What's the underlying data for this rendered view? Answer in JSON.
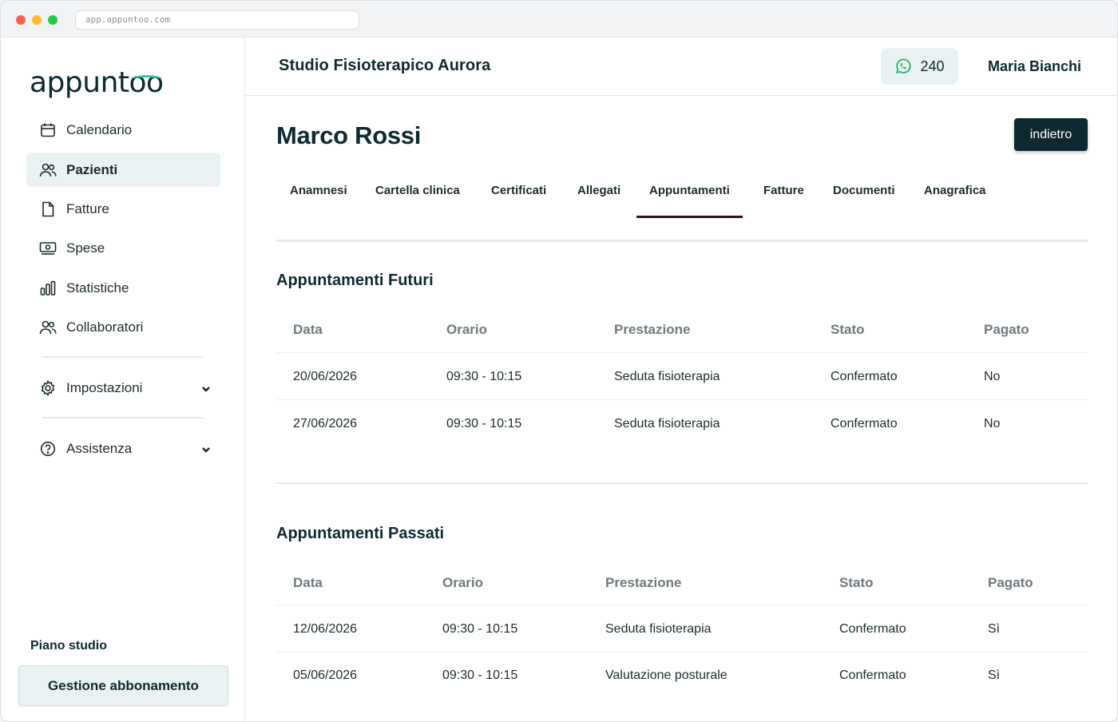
{
  "browser": {
    "url": "app.appuntoo.com"
  },
  "app": {
    "logo_text_a": "appunt",
    "logo_text_b": "oo"
  },
  "sidebar": {
    "items": [
      {
        "label": "Calendario",
        "icon": "calendar-icon"
      },
      {
        "label": "Pazienti",
        "icon": "users-icon",
        "active": true
      },
      {
        "label": "Fatture",
        "icon": "document-icon"
      },
      {
        "label": "Spese",
        "icon": "cash-icon"
      },
      {
        "label": "Statistiche",
        "icon": "bar-chart-icon"
      },
      {
        "label": "Collaboratori",
        "icon": "team-icon"
      },
      {
        "label": "Impostazioni",
        "icon": "gear-icon"
      },
      {
        "label": "Assistenza",
        "icon": "help-icon"
      }
    ],
    "plan_title": "Piano studio",
    "plan_button": "Gestione abbonamento"
  },
  "header": {
    "studio_name": "Studio Fisioterapico Aurora",
    "whatsapp_count": "240",
    "user_name": "Maria Bianchi"
  },
  "patient": {
    "name": "Marco Rossi",
    "back_label": "indietro"
  },
  "tabs": [
    {
      "label": "Anamnesi"
    },
    {
      "label": "Cartella clinica"
    },
    {
      "label": "Certificati"
    },
    {
      "label": "Allegati"
    },
    {
      "label": "Appuntamenti",
      "active": true
    },
    {
      "label": "Fatture"
    },
    {
      "label": "Documenti"
    },
    {
      "label": "Anagrafica"
    }
  ],
  "future": {
    "title": "Appuntamenti Futuri",
    "columns": [
      "Data",
      "Orario",
      "Prestazione",
      "Stato",
      "Pagato"
    ],
    "rows": [
      [
        "20/06/2026",
        "09:30 - 10:15",
        "Seduta fisioterapia",
        "Confermato",
        "No"
      ],
      [
        "27/06/2026",
        "09:30 - 10:15",
        "Seduta fisioterapia",
        "Confermato",
        "No"
      ]
    ]
  },
  "past": {
    "title": "Appuntamenti Passati",
    "columns": [
      "Data",
      "Orario",
      "Prestazione",
      "Stato",
      "Pagato"
    ],
    "rows": [
      [
        "12/06/2026",
        "09:30 - 10:15",
        "Seduta fisioterapia",
        "Confermato",
        "Sì"
      ],
      [
        "05/06/2026",
        "09:30 - 10:15",
        "Valutazione posturale",
        "Confermato",
        "Sì"
      ]
    ]
  },
  "colors": {
    "accent_dark": "#0e2a30",
    "logo_accent": "#3cc6a8",
    "tab_underline": "#3b1010",
    "whatsapp": "#25b36b"
  }
}
